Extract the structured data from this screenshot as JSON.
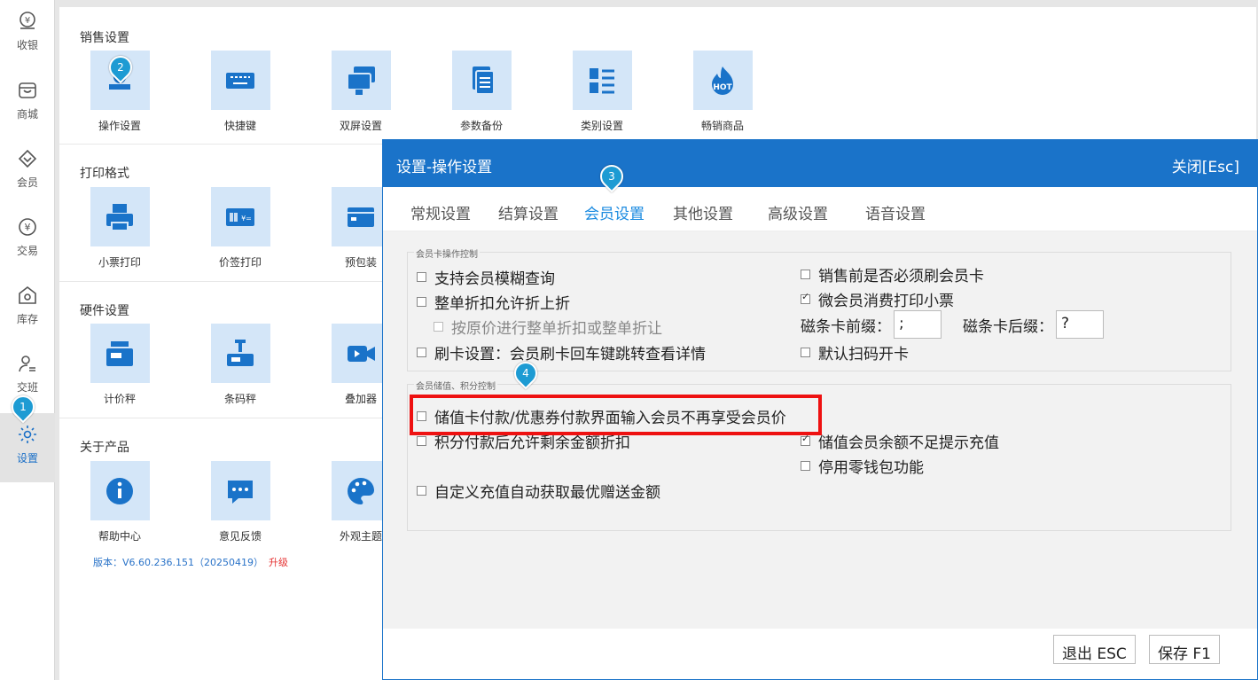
{
  "sidebar": {
    "items": [
      {
        "label": "收银",
        "icon": "cashier-icon"
      },
      {
        "label": "商城",
        "icon": "shop-icon"
      },
      {
        "label": "会员",
        "icon": "member-icon"
      },
      {
        "label": "交易",
        "icon": "transaction-icon"
      },
      {
        "label": "库存",
        "icon": "inventory-icon"
      },
      {
        "label": "交班",
        "icon": "shift-icon"
      },
      {
        "label": "设置",
        "icon": "settings-icon"
      }
    ]
  },
  "main": {
    "sections": [
      {
        "title": "销售设置",
        "tiles": [
          "操作设置",
          "快捷键",
          "双屏设置",
          "参数备份",
          "类别设置",
          "畅销商品"
        ]
      },
      {
        "title": "打印格式",
        "tiles": [
          "小票打印",
          "价签打印",
          "预包装"
        ]
      },
      {
        "title": "硬件设置",
        "tiles": [
          "计价秤",
          "条码秤",
          "叠加器"
        ]
      },
      {
        "title": "关于产品",
        "tiles": [
          "帮助中心",
          "意见反馈",
          "外观主题"
        ]
      }
    ],
    "hot_badge": "HOT",
    "version": "版本：V6.60.236.151（20250419）",
    "upgrade": "升级"
  },
  "dialog": {
    "title": "设置-操作设置",
    "close": "关闭[Esc]",
    "tabs": [
      "常规设置",
      "结算设置",
      "会员设置",
      "其他设置",
      "高级设置",
      "语音设置"
    ],
    "active_tab": "会员设置",
    "group1": {
      "title": "会员卡操作控制",
      "fuzzy": "支持会员模糊查询",
      "discount": "整单折扣允许折上折",
      "orig_price": "按原价进行整单折扣或整单折让",
      "swipe": "刷卡设置：会员刷卡回车键跳转查看详情",
      "must_swipe": "销售前是否必须刷会员卡",
      "wechat_print": "微会员消费打印小票",
      "prefix_label": "磁条卡前缀：",
      "prefix_value": ";",
      "suffix_label": "磁条卡后缀：",
      "suffix_value": "?",
      "scan_open": "默认扫码开卡"
    },
    "group2": {
      "title": "会员储值、积分控制",
      "stored_value": "储值卡付款/优惠券付款界面输入会员不再享受会员价",
      "points": "积分付款后允许剩余金额折扣",
      "custom_recharge": "自定义充值自动获取最优赠送金额",
      "insufficient": "储值会员余额不足提示充值",
      "disable_wallet": "停用零钱包功能"
    },
    "buttons": {
      "exit": "退出 ESC",
      "save": "保存 F1"
    }
  },
  "markers": [
    "1",
    "2",
    "3",
    "4"
  ],
  "colors": {
    "accent": "#1a73c9",
    "tile_bg": "#d4e6f8",
    "highlight": "#e11111"
  }
}
